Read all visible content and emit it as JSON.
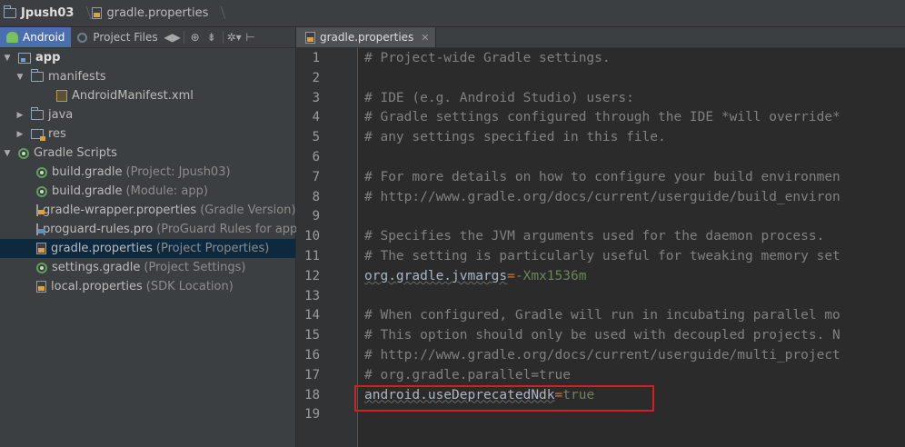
{
  "breadcrumb": {
    "project": "Jpush03",
    "file": "gradle.properties"
  },
  "left_panel": {
    "tabs": [
      {
        "label": "Android",
        "icon": "android-icon",
        "active": true
      },
      {
        "label": "Project Files",
        "icon": "globe-icon",
        "active": false
      }
    ],
    "toolbar_icons": [
      "swap-arrows-icon",
      "target-icon",
      "collapse-all-icon",
      "settings-icon",
      "pin-icon"
    ],
    "tree": [
      {
        "label": "app",
        "hint": "",
        "icon": "module-icon",
        "indent": 0,
        "arrow": "▼"
      },
      {
        "label": "manifests",
        "hint": "",
        "icon": "folder-icon",
        "indent": 1,
        "arrow": "▼"
      },
      {
        "label": "AndroidManifest.xml",
        "hint": "",
        "icon": "xml-icon",
        "indent": 2,
        "arrow": ""
      },
      {
        "label": "java",
        "hint": "",
        "icon": "folder-icon",
        "indent": 1,
        "arrow": "▶"
      },
      {
        "label": "res",
        "hint": "",
        "icon": "res-icon",
        "indent": 1,
        "arrow": "▶"
      },
      {
        "label": "Gradle Scripts",
        "hint": "",
        "icon": "gradle-icon",
        "indent": 0,
        "arrow": "▼"
      },
      {
        "label": "build.gradle",
        "hint": "(Project: Jpush03)",
        "icon": "gradle-icon",
        "indent": 1,
        "arrow": ""
      },
      {
        "label": "build.gradle",
        "hint": "(Module: app)",
        "icon": "gradle-icon",
        "indent": 1,
        "arrow": ""
      },
      {
        "label": "gradle-wrapper.properties",
        "hint": "(Gradle Version)",
        "icon": "properties-icon",
        "indent": 1,
        "arrow": ""
      },
      {
        "label": "proguard-rules.pro",
        "hint": "(ProGuard Rules for app)",
        "icon": "file-icon",
        "indent": 1,
        "arrow": ""
      },
      {
        "label": "gradle.properties",
        "hint": "(Project Properties)",
        "icon": "properties-icon",
        "indent": 1,
        "arrow": "",
        "selected": true
      },
      {
        "label": "settings.gradle",
        "hint": "(Project Settings)",
        "icon": "gradle-icon",
        "indent": 1,
        "arrow": ""
      },
      {
        "label": "local.properties",
        "hint": "(SDK Location)",
        "icon": "properties-icon",
        "indent": 1,
        "arrow": ""
      }
    ]
  },
  "editor": {
    "tab_label": "gradle.properties",
    "lines": [
      {
        "n": "1",
        "parts": [
          {
            "t": "# Project-wide Gradle settings.",
            "c": "cmt"
          }
        ]
      },
      {
        "n": "2",
        "parts": []
      },
      {
        "n": "3",
        "parts": [
          {
            "t": "# IDE (e.g. Android Studio) users:",
            "c": "cmt"
          }
        ]
      },
      {
        "n": "4",
        "parts": [
          {
            "t": "# Gradle settings configured through the IDE *will override*",
            "c": "cmt"
          }
        ]
      },
      {
        "n": "5",
        "parts": [
          {
            "t": "# any settings specified in this file.",
            "c": "cmt"
          }
        ]
      },
      {
        "n": "6",
        "parts": []
      },
      {
        "n": "7",
        "parts": [
          {
            "t": "# For more details on how to configure your build environmen",
            "c": "cmt"
          }
        ]
      },
      {
        "n": "8",
        "parts": [
          {
            "t": "# http://www.gradle.org/docs/current/userguide/build_environ",
            "c": "cmt"
          }
        ]
      },
      {
        "n": "9",
        "parts": []
      },
      {
        "n": "10",
        "parts": [
          {
            "t": "# Specifies the JVM arguments used for the daemon process.",
            "c": "cmt"
          }
        ]
      },
      {
        "n": "11",
        "parts": [
          {
            "t": "# The setting is particularly useful for tweaking memory set",
            "c": "cmt"
          }
        ]
      },
      {
        "n": "12",
        "parts": [
          {
            "t": "org.gradle.jvmargs",
            "c": "key"
          },
          {
            "t": "=",
            "c": "eq"
          },
          {
            "t": "-Xmx1536m",
            "c": "val"
          }
        ]
      },
      {
        "n": "13",
        "parts": []
      },
      {
        "n": "14",
        "parts": [
          {
            "t": "# When configured, Gradle will run in incubating parallel mo",
            "c": "cmt"
          }
        ]
      },
      {
        "n": "15",
        "parts": [
          {
            "t": "# This option should only be used with decoupled projects. N",
            "c": "cmt"
          }
        ]
      },
      {
        "n": "16",
        "parts": [
          {
            "t": "# http://www.gradle.org/docs/current/userguide/multi_project",
            "c": "cmt"
          }
        ]
      },
      {
        "n": "17",
        "parts": [
          {
            "t": "# org.gradle.parallel=true",
            "c": "cmt"
          }
        ]
      },
      {
        "n": "18",
        "parts": [
          {
            "t": "android.useDeprecatedNdk",
            "c": "key"
          },
          {
            "t": "=",
            "c": "eq"
          },
          {
            "t": "true",
            "c": "val"
          }
        ]
      },
      {
        "n": "19",
        "parts": []
      }
    ]
  },
  "colors": {
    "highlight_box": "#d31f24",
    "selection": "#0d293e",
    "comment": "#808080",
    "value": "#6a8759",
    "operator": "#cc7832"
  }
}
